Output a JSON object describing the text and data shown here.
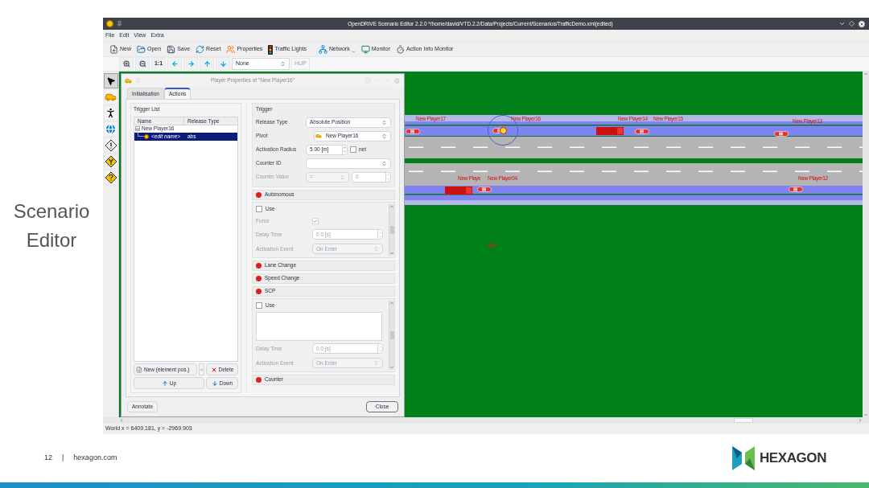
{
  "slide": {
    "title": "Scenario Editor",
    "page": "12",
    "separator": "|",
    "site": "hexagon.com",
    "logo": "HEXAGON"
  },
  "window": {
    "title": "OpenDRIVE Scenario Editor 2.2.0 */home/david/VTD.2.2/Data/Projects/Current/Scenarios/TrafficDemo.xml(edited)"
  },
  "menu": [
    "File",
    "Edit",
    "View",
    "Extra"
  ],
  "toolbar": [
    {
      "kind": "new",
      "label": "New"
    },
    {
      "kind": "open",
      "label": "Open"
    },
    {
      "kind": "save",
      "label": "Save"
    },
    {
      "kind": "reset",
      "label": "Reset"
    },
    {
      "kind": "properties",
      "label": "Properties"
    },
    {
      "kind": "lights",
      "label": "Traffic Lights"
    },
    {
      "kind": "network",
      "label": "Network",
      "menu": true
    },
    {
      "kind": "monitor",
      "label": "Monitor"
    },
    {
      "kind": "timer",
      "label": "Action Info Monitor"
    }
  ],
  "nav_toolbar": {
    "buttons": [
      {
        "kind": "zoom-in"
      },
      {
        "kind": "zoom-out"
      },
      {
        "kind": "actual",
        "label": "1:1"
      },
      {
        "kind": "left"
      },
      {
        "kind": "right"
      },
      {
        "kind": "up"
      },
      {
        "kind": "down"
      }
    ],
    "select": "None",
    "hup": {
      "label": "HUP",
      "disabled": true
    }
  },
  "palette": [
    {
      "kind": "pointer",
      "selected": true
    },
    {
      "kind": "car",
      "selected": false
    },
    {
      "kind": "pedestrian",
      "selected": false
    },
    {
      "kind": "globe",
      "selected": false
    },
    {
      "kind": "warning",
      "selected": false
    },
    {
      "kind": "fork",
      "selected": false
    },
    {
      "kind": "question",
      "selected": false
    }
  ],
  "dialog": {
    "title": "Player Properties of \"New Player16\"",
    "tabs": [
      {
        "label": "Initialisation",
        "selected": false
      },
      {
        "label": "Actions",
        "selected": true
      }
    ],
    "trigger_list": {
      "title": "Trigger List",
      "columns": [
        "Name",
        "Release Type"
      ],
      "tree": [
        {
          "name": "New Player16",
          "expanded": true,
          "children": [
            {
              "name": "<edit name>",
              "release_type": "abs",
              "selected": true
            }
          ]
        }
      ],
      "buttons": {
        "new": "New (element pos.)",
        "delete": "Delete",
        "up": "Up",
        "down": "Down"
      }
    },
    "trigger": {
      "title": "Trigger",
      "fields": [
        {
          "kind": "select",
          "label": "Release Type",
          "value": "Absolute Position"
        },
        {
          "kind": "select",
          "label": "Pivot",
          "value": "New Player16"
        },
        {
          "kind": "spin",
          "label": "Activation Radius",
          "value": "5.00 [m]",
          "checkbox": {
            "label": "net",
            "checked": false
          }
        },
        {
          "kind": "select",
          "label": "Counter ID"
        },
        {
          "kind": "pair",
          "label": "Counter Value",
          "value": "=",
          "value2": "0",
          "disabled": true
        }
      ]
    },
    "actions": [
      {
        "title": "Autonomous",
        "use": {
          "label": "Use",
          "checked": false
        },
        "rows": [
          {
            "kind": "check",
            "label": "Force",
            "checked": true
          },
          {
            "kind": "spin",
            "label": "Delay Time",
            "value": "0.0 [s]"
          },
          {
            "kind": "select",
            "label": "Activation Event",
            "value": "On Enter"
          }
        ]
      },
      {
        "title": "Lane Change"
      },
      {
        "title": "Speed Change"
      },
      {
        "title": "SCP",
        "use": {
          "label": "Use",
          "checked": false
        },
        "rows": [
          {
            "kind": "textarea"
          },
          {
            "kind": "spin",
            "label": "Delay Time",
            "value": "0.0 [s]"
          },
          {
            "kind": "select",
            "label": "Activation Event",
            "value": "On Enter"
          }
        ]
      },
      {
        "title": "Counter"
      }
    ],
    "buttons": {
      "annotate": "Annotate",
      "close": "Close"
    }
  },
  "players": [
    {
      "label": "New Player17",
      "kind": "car",
      "selected": false
    },
    {
      "label": "New Player16",
      "kind": "car",
      "selected": true
    },
    {
      "label": "New Player14",
      "kind": "truck",
      "selected": false
    },
    {
      "label": "New Player15",
      "kind": "car",
      "selected": false
    },
    {
      "label": "New Player13",
      "kind": "car",
      "selected": false
    },
    {
      "label": "New Playe",
      "kind": "truck",
      "selected": false
    },
    {
      "label": "New Player04",
      "kind": "car",
      "selected": false
    },
    {
      "label": "New Player12",
      "kind": "car",
      "selected": false
    }
  ],
  "status_bar": "World x = 6409.181, y = -2969.903"
}
